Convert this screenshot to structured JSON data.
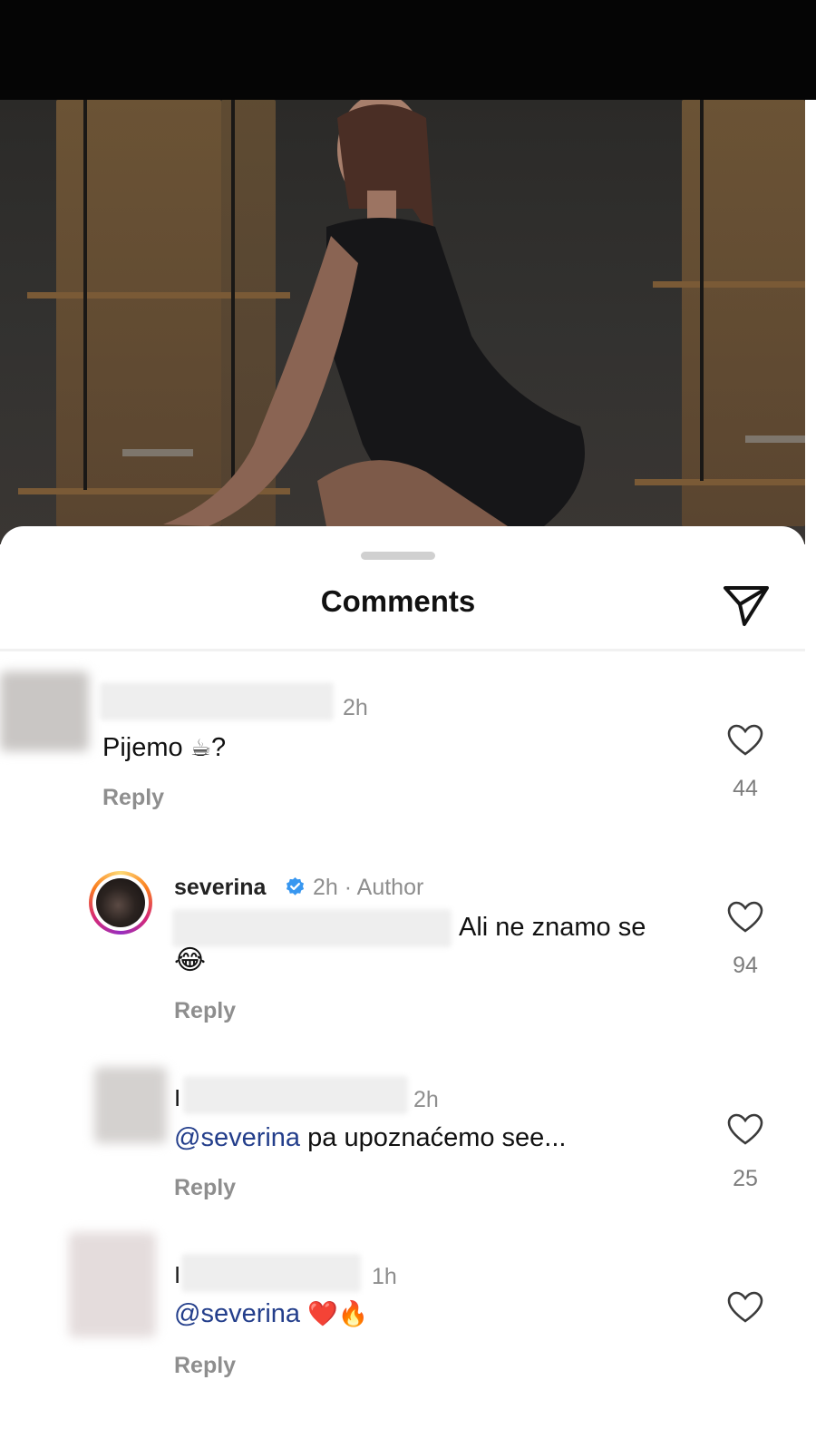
{
  "sheet": {
    "title": "Comments",
    "share_icon": "paper-plane-icon"
  },
  "comments": [
    {
      "time": "2h",
      "text": "Pijemo",
      "emoji": "☕",
      "suffix": "?",
      "reply_label": "Reply",
      "likes": "44"
    },
    {
      "username": "severina",
      "verified": true,
      "time": "2h",
      "tag": "Author",
      "text": "Ali ne znamo se",
      "emoji": "😂",
      "reply_label": "Reply",
      "likes": "94"
    },
    {
      "username_initial": "I",
      "time": "2h",
      "mention": "@severina",
      "text": "pa upoznaćemo see...",
      "reply_label": "Reply",
      "likes": "25"
    },
    {
      "username_initial": "I",
      "time": "1h",
      "mention": "@severina",
      "emoji": "❤️🔥",
      "reply_label": "Reply",
      "likes": ""
    }
  ],
  "colors": {
    "mention": "#233e8b",
    "muted": "#8e8e8e",
    "verified": "#3897f0"
  }
}
